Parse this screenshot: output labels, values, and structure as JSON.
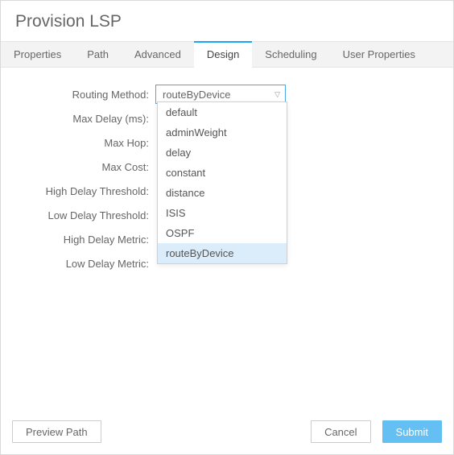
{
  "window": {
    "title": "Provision LSP"
  },
  "tabs": [
    {
      "label": "Properties",
      "active": false
    },
    {
      "label": "Path",
      "active": false
    },
    {
      "label": "Advanced",
      "active": false
    },
    {
      "label": "Design",
      "active": true
    },
    {
      "label": "Scheduling",
      "active": false
    },
    {
      "label": "User Properties",
      "active": false
    }
  ],
  "form": {
    "routing_method": {
      "label": "Routing Method:",
      "value": "routeByDevice"
    },
    "max_delay": {
      "label": "Max Delay (ms):"
    },
    "max_hop": {
      "label": "Max Hop:"
    },
    "max_cost": {
      "label": "Max Cost:"
    },
    "high_delay_threshold": {
      "label": "High Delay Threshold:"
    },
    "low_delay_threshold": {
      "label": "Low Delay Threshold:"
    },
    "high_delay_metric": {
      "label": "High Delay Metric:"
    },
    "low_delay_metric": {
      "label": "Low Delay Metric:"
    }
  },
  "routing_method_options": [
    "default",
    "adminWeight",
    "delay",
    "constant",
    "distance",
    "ISIS",
    "OSPF",
    "routeByDevice"
  ],
  "footer": {
    "preview_path": "Preview Path",
    "cancel": "Cancel",
    "submit": "Submit"
  }
}
